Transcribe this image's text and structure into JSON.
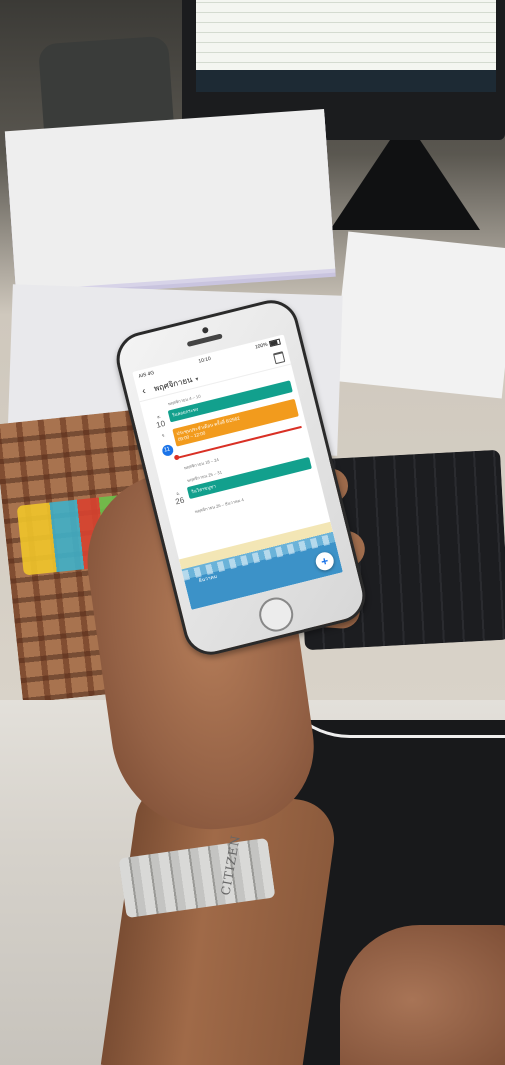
{
  "watch": {
    "brand": "CITIZEN"
  },
  "phone": {
    "status_bar": {
      "carrier": "AIS 4G",
      "time": "10:10",
      "battery": "100%"
    },
    "app_bar": {
      "month_title": "พฤศจิกายน",
      "back_icon": "back-arrow-icon",
      "dropdown_icon": "chevron-down-icon",
      "calendar_icon": "calendar-icon"
    },
    "agenda": {
      "weeks": [
        {
          "label": "พฤศจิกายน 4 – 10",
          "day": {
            "dow": "ส.",
            "number": "10",
            "today": false
          },
          "events": [
            {
              "title": "วันลอยกระทง",
              "color": "#12a08d"
            }
          ]
        },
        {
          "label": "",
          "day": {
            "dow": "จ.",
            "number": "11",
            "today": true
          },
          "events": [
            {
              "title": "ประชุมประจำเดือน ครั้งที่ 6/2562",
              "time": "09:00 – 12:00",
              "color": "#f29b1d"
            }
          ]
        },
        {
          "label": "พฤศจิกายน 18 – 24",
          "day": null,
          "events": []
        },
        {
          "label": "พฤศจิกายน 25 – 31",
          "day": {
            "dow": "อ.",
            "number": "26",
            "today": false
          },
          "events": [
            {
              "title": "วันวิสาขบูชา",
              "color": "#12a08d"
            }
          ]
        },
        {
          "label": "พฤศจิกายน 26 – ธันวาคม 4",
          "day": null,
          "events": []
        }
      ],
      "month_banner": "ธันวาคม"
    },
    "fab_icon": "plus-icon"
  }
}
